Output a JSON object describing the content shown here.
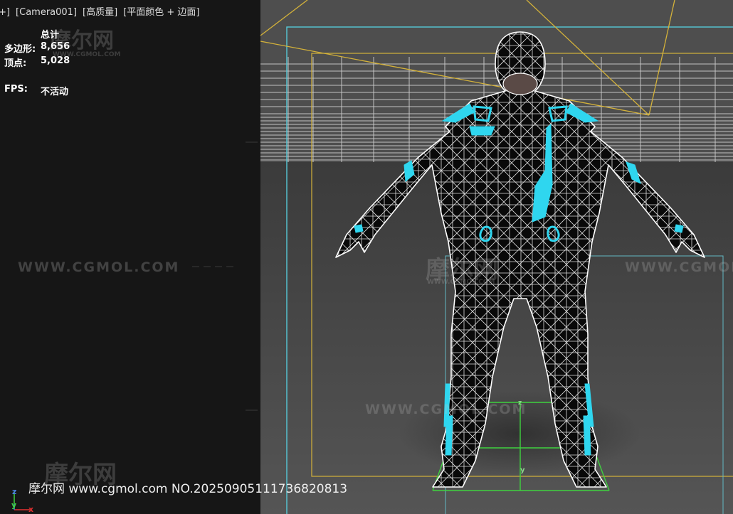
{
  "viewport_label": {
    "plus": "[+]",
    "camera": "[Camera001]",
    "quality": "[高质量]",
    "shading": "[平面颜色 + 边面]"
  },
  "stats": {
    "header": "总计",
    "polygons_label": "多边形:",
    "polygons_value": "8,656",
    "vertices_label": "顶点:",
    "vertices_value": "5,028",
    "fps_label": "FPS:",
    "fps_value": "不活动"
  },
  "watermark": {
    "site": "WWW.CGMOL.COM",
    "logo": "摩尔网",
    "small": "WWW.CGMOL.COM"
  },
  "footer_text": "摩尔网 www.cgmol.com NO.20250905111736820813",
  "axis": {
    "x": "x",
    "y": "y",
    "z": "z"
  },
  "colors": {
    "wire": "#ffffff",
    "accent": "#2fd6ef",
    "safe_frame_outer": "#56c9d8",
    "safe_frame_inner": "#d4b23a",
    "grid_green": "#3fd23f"
  }
}
